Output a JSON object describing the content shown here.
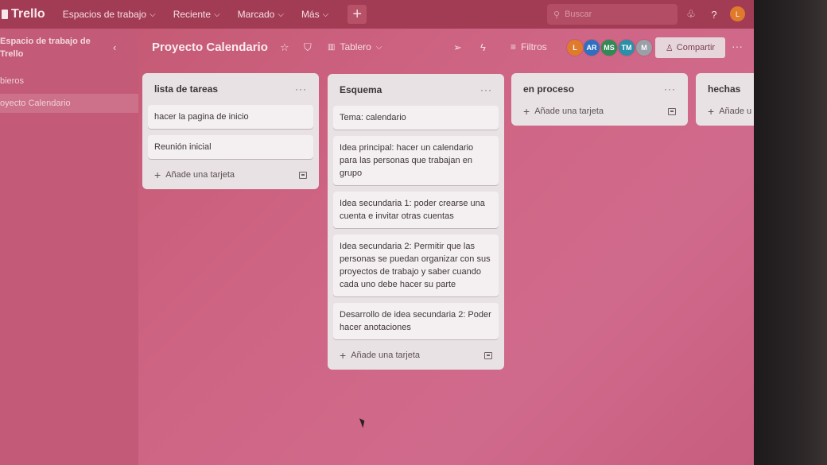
{
  "app": {
    "name": "Trello"
  },
  "topbar": {
    "menus": [
      {
        "label": "Espacios de trabajo"
      },
      {
        "label": "Reciente"
      },
      {
        "label": "Marcado"
      },
      {
        "label": "Más"
      }
    ],
    "search_placeholder": "Buscar",
    "user_initial": "L"
  },
  "sidebar": {
    "workspace_title": "Espacio de trabajo de Trello",
    "section_label": "bieros",
    "board_item": "oyecto Calendario"
  },
  "board": {
    "title": "Proyecto Calendario",
    "view_label": "Tablero",
    "filters_label": "Filtros",
    "members": [
      {
        "initials": "L",
        "color": "#e07b2b"
      },
      {
        "initials": "AR",
        "color": "#2f6fc2"
      },
      {
        "initials": "MS",
        "color": "#2f8a55"
      },
      {
        "initials": "TM",
        "color": "#2a8fa8"
      },
      {
        "initials": "M",
        "color": "#9aa0a8"
      }
    ],
    "share_label": "Compartir"
  },
  "lists": [
    {
      "title": "lista de tareas",
      "cards": [
        "hacer la pagina de inicio",
        "Reunión inicial"
      ],
      "add_label": "Añade una tarjeta"
    },
    {
      "title": "Esquema",
      "cards": [
        "Tema: calendario",
        "Idea principal: hacer un calendario para las personas que trabajan en grupo",
        "Idea secundaria 1: poder crearse una cuenta e invitar otras cuentas",
        "Idea secundaria 2: Permitir que las personas se puedan organizar con sus proyectos de trabajo y saber cuando cada uno debe hacer su parte",
        "Desarrollo de idea secundaria 2: Poder hacer anotaciones"
      ],
      "add_label": "Añade una tarjeta"
    },
    {
      "title": "en proceso",
      "cards": [],
      "add_label": "Añade una tarjeta"
    },
    {
      "title": "hechas",
      "cards": [],
      "add_label": "Añade u"
    }
  ],
  "colors": {
    "topbar": "#a23c55",
    "board_bg": "#cf6585",
    "list_bg": "#e9e2e5"
  }
}
